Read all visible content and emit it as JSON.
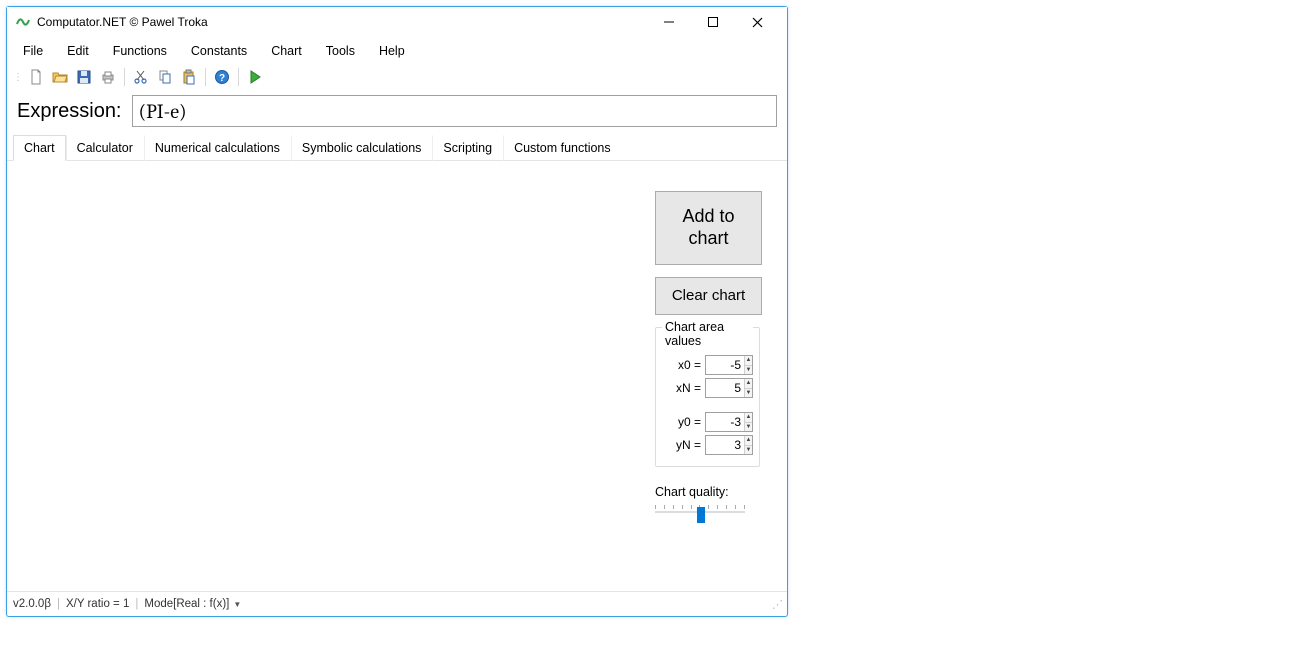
{
  "title": "Computator.NET © Pawel Troka",
  "menu": {
    "file": "File",
    "edit": "Edit",
    "functions": "Functions",
    "constants": "Constants",
    "chart": "Chart",
    "tools": "Tools",
    "help": "Help"
  },
  "expression": {
    "label": "Expression:",
    "value": "(PI-e)"
  },
  "tabs": {
    "chart": "Chart",
    "calculator": "Calculator",
    "numerical": "Numerical calculations",
    "symbolic": "Symbolic calculations",
    "scripting": "Scripting",
    "custom": "Custom functions"
  },
  "panel": {
    "addToChart": "Add to\nchart",
    "clearChart": "Clear chart",
    "chartArea": {
      "legend": "Chart area values",
      "x0Label": "x0 =",
      "x0": "-5",
      "xNLabel": "xN =",
      "xN": "5",
      "y0Label": "y0 =",
      "y0": "-3",
      "yNLabel": "yN =",
      "yN": "3"
    },
    "qualityLabel": "Chart quality:"
  },
  "status": {
    "version": "v2.0.0β",
    "ratio": "X/Y ratio = 1",
    "mode": "Mode[Real : f(x)]"
  }
}
